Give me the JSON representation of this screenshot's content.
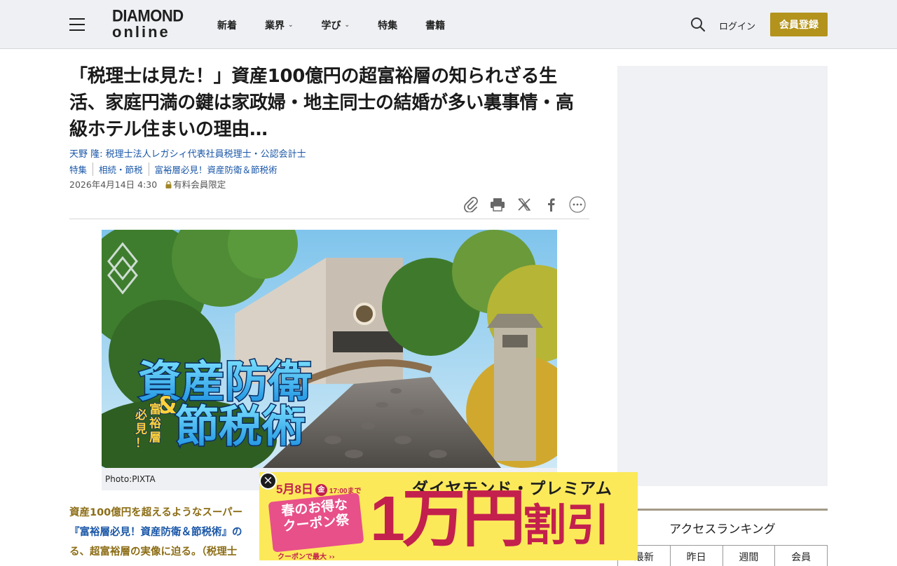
{
  "header": {
    "logo_line1": "DIAMOND",
    "logo_line2": "online",
    "nav": [
      {
        "label": "新着",
        "has_dropdown": false
      },
      {
        "label": "業界",
        "has_dropdown": true
      },
      {
        "label": "学び",
        "has_dropdown": true
      },
      {
        "label": "特集",
        "has_dropdown": false
      },
      {
        "label": "書籍",
        "has_dropdown": false
      }
    ],
    "login_label": "ログイン",
    "register_label": "会員登録",
    "accent_color": "#b3931c"
  },
  "article": {
    "title": "「税理士は見た！」資産100億円の超富裕層の知られざる生活、家庭円満の鍵は家政婦・地主同士の結婚が多い裏事情・高級ホテル住まいの理由…",
    "author": "天野 隆: 税理士法人レガシィ代表社員税理士・公認会計士",
    "tags": [
      "特集",
      "相続・節税",
      "富裕層必見！資産防衛＆節税術"
    ],
    "date": "2026年4月14日 4:30",
    "member_label": "有料会員限定",
    "share_icons": [
      "link-icon",
      "print-icon",
      "x-icon",
      "facebook-icon",
      "more-icon"
    ],
    "hero": {
      "headline_line1": "資産防衛",
      "headline_amp": "&",
      "headline_line2": "節税術",
      "side_text": "富裕層必見！"
    },
    "caption": "Photo:PIXTA",
    "lead_part1": "資産100億円を超えるようなスーパー",
    "lead_part2": "『富裕層必見！資産防衛＆節税術』の",
    "lead_part3": "る、超富裕層の実像に迫る。（税理士"
  },
  "sidebar": {
    "ranking_title": "アクセスランキング",
    "ranking_tabs": [
      "最新",
      "昨日",
      "週間",
      "会員"
    ]
  },
  "banner": {
    "date": "5月8日",
    "weekday": "金",
    "time": "17:00まで",
    "premium": "ダイヤモンド・プレミアム",
    "badge_line1": "春のお得な",
    "badge_line2": "クーポン祭",
    "badge_sub": "クーポンで最大 ››",
    "big_amount": "1万円",
    "big_suffix": "割引",
    "close_symbol": "×"
  }
}
